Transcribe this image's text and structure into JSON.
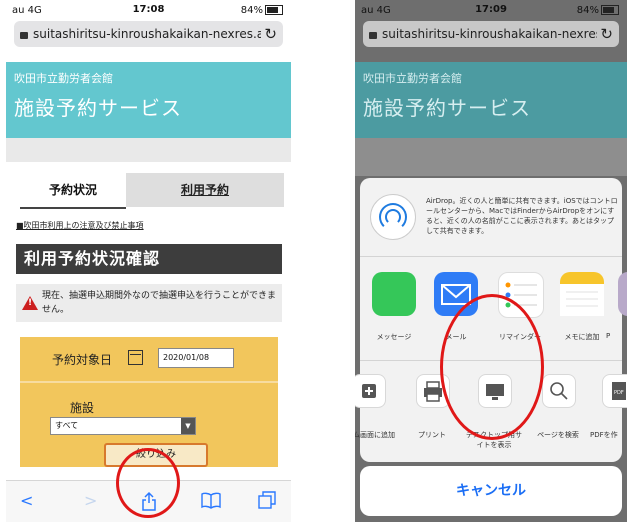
{
  "phone1": {
    "status": {
      "carrier": "au 4G",
      "time": "17:08",
      "battery": "84%"
    },
    "url": "suitashiritsu-kinroushakaikan-nexres.a",
    "header": {
      "subtitle": "吹田市立勤労者会館",
      "title": "施設予約サービス"
    },
    "tabs": [
      "予約状況",
      "利用予約"
    ],
    "notice_link": "■吹田市利用上の注意及び禁止事項",
    "section_title": "利用予約状況確認",
    "alert_text": "現在、抽選申込期間外なので抽選申込を行うことができません。",
    "form": {
      "date_label": "予約対象日",
      "date_value": "2020/01/08",
      "facility_label": "施設",
      "facility_value": "すべて",
      "filter_button": "絞り込み"
    },
    "toolbar": {
      "back": "<",
      "forward": ">",
      "share": "share",
      "bookmarks": "bookmarks",
      "tabs": "tabs"
    }
  },
  "phone2": {
    "status": {
      "carrier": "au 4G",
      "time": "17:09",
      "battery": "84%"
    },
    "url": "suitashiritsu-kinroushakaikan-nexres.a",
    "header": {
      "subtitle": "吹田市立勤労者会館",
      "title": "施設予約サービス"
    },
    "airdrop_text": "AirDrop。近くの人と簡単に共有できます。iOSではコントロールセンターから、MacではFinderからAirDropをオンにすると、近くの人の名前がここに表示されます。あとはタップして共有できます。",
    "apps": [
      {
        "label": "メッセージ",
        "color": "#35c759"
      },
      {
        "label": "メール",
        "color": "#2f7cf6"
      },
      {
        "label": "リマインダー",
        "color": "#ffffff"
      },
      {
        "label": "メモに追加",
        "color": "#f7c52b"
      },
      {
        "label": "P",
        "color": "#b8a9c9"
      }
    ],
    "actions": [
      {
        "label": "ム画面に追加"
      },
      {
        "label": "プリント"
      },
      {
        "label": "デスクトップ用サイトを表示"
      },
      {
        "label": "ページを検索"
      },
      {
        "label": "PDFを作"
      }
    ],
    "cancel": "キャンセル"
  },
  "colors": {
    "accent": "#63c7cf",
    "annotation": "#e01818",
    "link": "#2a78ff"
  }
}
